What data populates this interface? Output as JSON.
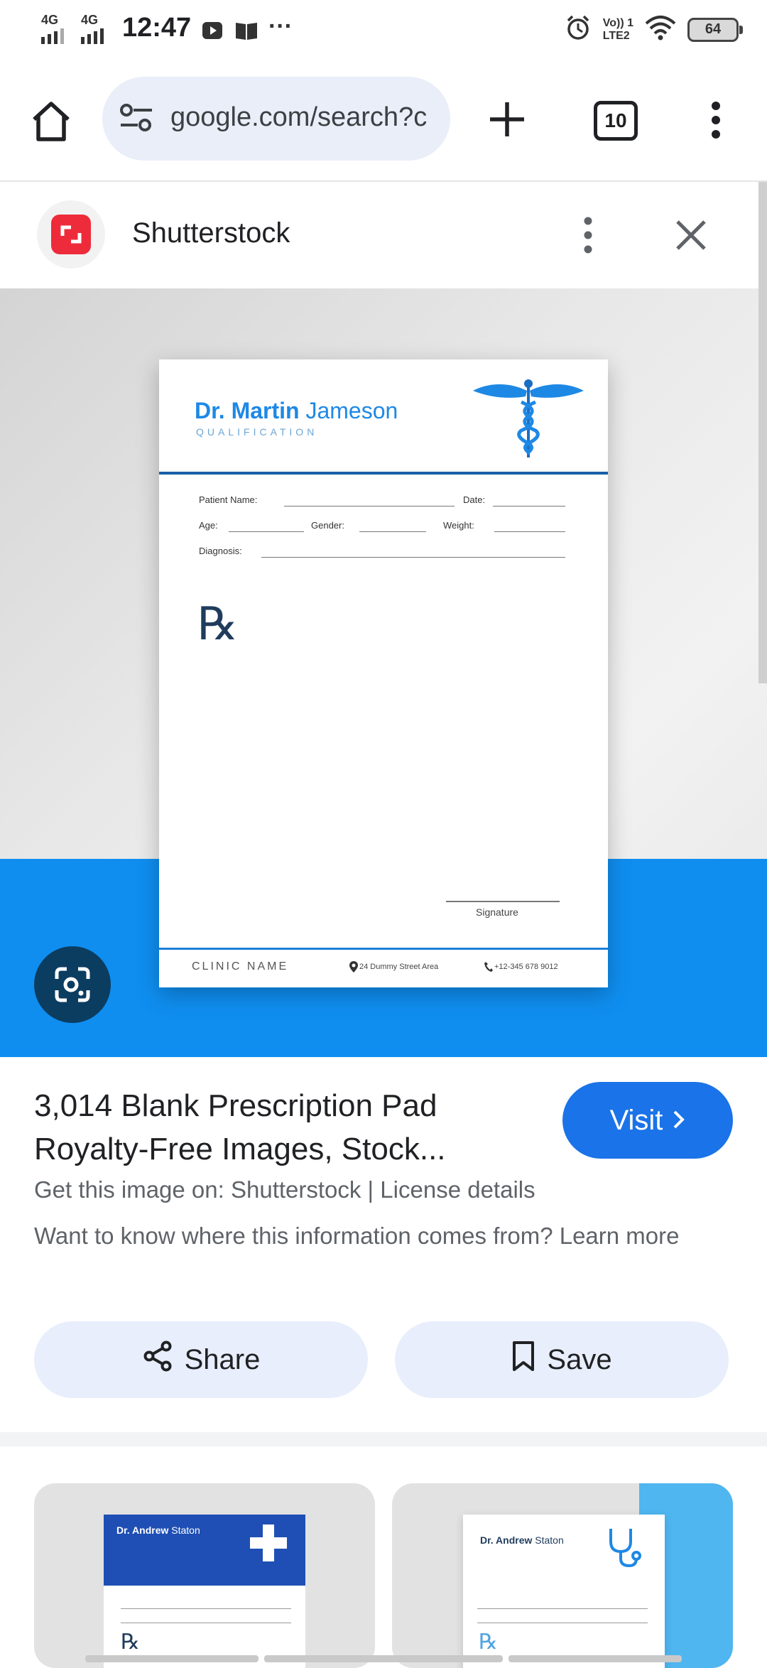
{
  "status_bar": {
    "time": "12:47",
    "signal1": "4G",
    "signal2": "4G",
    "volte": "Vo)) 1",
    "lte": "LTE2",
    "battery": "64"
  },
  "browser": {
    "url": "google.com/search?c",
    "tab_count": "10"
  },
  "source": {
    "name": "Shutterstock"
  },
  "preview_image": {
    "doctor_first": "Dr. Martin",
    "doctor_last": "Jameson",
    "qualification": "QUALIFICATION",
    "patient_name": "Patient Name:",
    "date": "Date:",
    "age": "Age:",
    "gender": "Gender:",
    "weight": "Weight:",
    "diagnosis": "Diagnosis:",
    "rx": "℞",
    "signature": "Signature",
    "clinic": "CLINIC NAME",
    "address": "24 Dummy Street Area",
    "phone": "+12-345 678 9012"
  },
  "result": {
    "title": "3,014 Blank Prescription Pad Royalty-Free Images, Stock...",
    "visit_label": "Visit",
    "source_line": "Get this image on: Shutterstock | License details",
    "note": "Want to know where this information comes from? Learn more"
  },
  "actions": {
    "share_label": "Share",
    "save_label": "Save"
  },
  "related": [
    {
      "doctor_first": "Dr. Andrew",
      "doctor_last": "Staton",
      "rx": "℞"
    },
    {
      "doctor_first": "Dr. Andrew",
      "doctor_last": "Staton",
      "rx": "℞"
    }
  ],
  "colors": {
    "accent": "#1a73e8",
    "shutterstock_red": "#ee2b3b",
    "hero_blue": "#0f8ef0"
  }
}
